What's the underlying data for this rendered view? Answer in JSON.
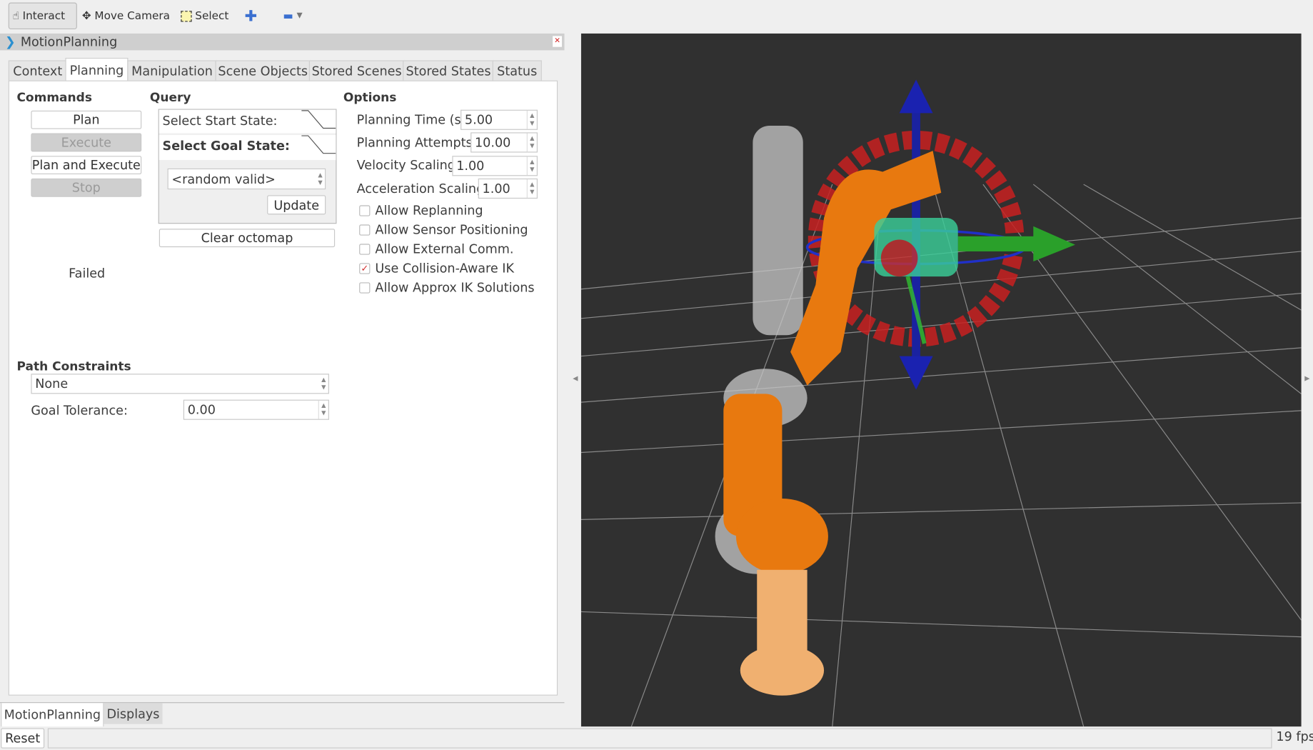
{
  "toolbar": {
    "interact": "Interact",
    "move_camera": "Move Camera",
    "select": "Select"
  },
  "panel": {
    "title": "MotionPlanning"
  },
  "tabs": [
    "Context",
    "Planning",
    "Manipulation",
    "Scene Objects",
    "Stored Scenes",
    "Stored States",
    "Status"
  ],
  "commands": {
    "header": "Commands",
    "plan": "Plan",
    "execute": "Execute",
    "plan_execute": "Plan and Execute",
    "stop": "Stop",
    "status": "Failed"
  },
  "query": {
    "header": "Query",
    "start_state": "Select Start State:",
    "goal_state": "Select Goal State:",
    "goal_value": "<random valid>",
    "update": "Update",
    "clear_octomap": "Clear octomap"
  },
  "options": {
    "header": "Options",
    "planning_time_label": "Planning Time (s):",
    "planning_time": "5.00",
    "planning_attempts_label": "Planning Attempts:",
    "planning_attempts": "10.00",
    "velocity_label": "Velocity Scaling:",
    "velocity": "1.00",
    "accel_label": "Acceleration Scaling:",
    "accel": "1.00",
    "checkboxes": [
      {
        "label": "Allow Replanning",
        "checked": false
      },
      {
        "label": "Allow Sensor Positioning",
        "checked": false
      },
      {
        "label": "Allow External Comm.",
        "checked": false
      },
      {
        "label": "Use Collision-Aware IK",
        "checked": true
      },
      {
        "label": "Allow Approx IK Solutions",
        "checked": false
      }
    ]
  },
  "path_constraints": {
    "header": "Path Constraints",
    "value": "None",
    "goal_tolerance_label": "Goal Tolerance:",
    "goal_tolerance": "0.00"
  },
  "bottom_tabs": [
    "MotionPlanning",
    "Displays"
  ],
  "status_bar": {
    "reset": "Reset",
    "fps": "19 fps"
  },
  "colors": {
    "robot_orange": "#e8790f",
    "viewport_bg": "#303030",
    "check": "#d03030"
  }
}
